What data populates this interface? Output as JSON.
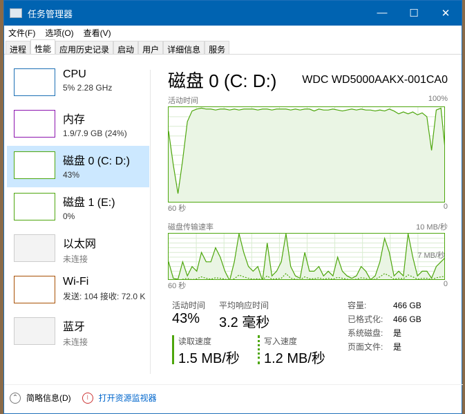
{
  "title": "任务管理器",
  "menu": [
    "文件(F)",
    "选项(O)",
    "查看(V)"
  ],
  "tabs": [
    "进程",
    "性能",
    "应用历史记录",
    "启动",
    "用户",
    "详细信息",
    "服务"
  ],
  "active_tab": "性能",
  "sidebar": [
    {
      "name": "CPU",
      "sub": "5% 2.28 GHz",
      "color": "#1b6fb4"
    },
    {
      "name": "内存",
      "sub": "1.9/7.9 GB (24%)",
      "color": "#8b12ae"
    },
    {
      "name": "磁盘 0 (C: D:)",
      "sub": "43%",
      "color": "#4da60c",
      "selected": true
    },
    {
      "name": "磁盘 1 (E:)",
      "sub": "0%",
      "color": "#4da60c"
    },
    {
      "name": "以太网",
      "sub": "未连接",
      "color": "#999"
    },
    {
      "name": "Wi-Fi",
      "sub": "发送: 104  接收: 72.0 K",
      "color": "#a74f01"
    },
    {
      "name": "蓝牙",
      "sub": "未连接",
      "color": "#999"
    }
  ],
  "main": {
    "title": "磁盘 0 (C: D:)",
    "model": "WDC WD5000AAKX-001CA0",
    "chart1": {
      "label": "活动时间",
      "max": "100%",
      "left": "60 秒",
      "right": "0",
      "values": [
        75,
        40,
        10,
        45,
        85,
        96,
        98,
        99,
        98,
        98,
        97,
        98,
        98,
        97,
        98,
        97,
        98,
        98,
        98,
        97,
        98,
        98,
        97,
        98,
        98,
        98,
        97,
        98,
        97,
        98,
        98,
        96,
        98,
        97,
        97,
        98,
        97,
        96,
        97,
        98,
        97,
        98,
        97,
        97,
        96,
        97,
        96,
        98,
        96,
        93,
        95,
        93,
        95,
        92,
        94,
        90,
        55,
        97,
        99,
        50
      ]
    },
    "chart2": {
      "label": "磁盘传输速率",
      "max": "10 MB/秒",
      "mid": "7 MB/秒",
      "left": "60 秒",
      "right": "0",
      "read": [
        4,
        0.5,
        0.3,
        4,
        1,
        3,
        2,
        6,
        4,
        4,
        7,
        5,
        2,
        0,
        4,
        10,
        6,
        3,
        2,
        3,
        0,
        8,
        1,
        2,
        4,
        10,
        3,
        1,
        0.5,
        6,
        2,
        2,
        3,
        1,
        2,
        1,
        5,
        2,
        1,
        0.5,
        1,
        3,
        2,
        0.2,
        1,
        4,
        9,
        6,
        1,
        2,
        1,
        10,
        5,
        1,
        2,
        2,
        0.5,
        3,
        4,
        5
      ],
      "write": [
        0.2,
        0.1,
        0.1,
        0.3,
        0.5,
        0.2,
        0.4,
        0.8,
        0.5,
        0.3,
        0.6,
        0.5,
        0.3,
        0.1,
        0.4,
        1.2,
        0.8,
        0.5,
        0.3,
        0.4,
        0.2,
        1,
        0.3,
        0.4,
        0.5,
        1.5,
        0.5,
        0.3,
        0.2,
        0.8,
        0.4,
        0.4,
        0.6,
        0.3,
        0.5,
        0.3,
        0.7,
        0.5,
        0.3,
        0.2,
        0.3,
        0.6,
        0.5,
        0.1,
        0.3,
        0.8,
        1.5,
        1,
        0.3,
        0.5,
        0.4,
        1.2,
        0.8,
        0.3,
        0.5,
        0.5,
        0.2,
        0.6,
        0.8,
        0.9
      ]
    },
    "stats": {
      "active_label": "活动时间",
      "active": "43%",
      "resp_label": "平均响应时间",
      "resp": "3.2 毫秒",
      "read_label": "读取速度",
      "read": "1.5 MB/秒",
      "write_label": "写入速度",
      "write": "1.2 MB/秒"
    },
    "props": [
      {
        "k": "容量:",
        "v": "466 GB"
      },
      {
        "k": "已格式化:",
        "v": "466 GB"
      },
      {
        "k": "系统磁盘:",
        "v": "是"
      },
      {
        "k": "页面文件:",
        "v": "是"
      }
    ]
  },
  "footer": {
    "summary": "简略信息(D)",
    "monitor": "打开资源监视器"
  }
}
